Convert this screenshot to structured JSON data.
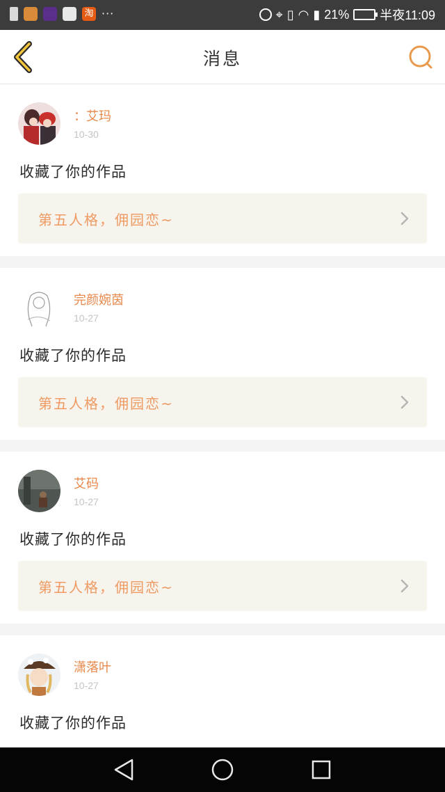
{
  "status_bar": {
    "battery_percent": "21%",
    "time": "半夜11:09",
    "app_badge": "淘",
    "overflow": "···"
  },
  "header": {
    "title": "消息",
    "accent_color": "#e89a4c"
  },
  "messages": [
    {
      "username": "：艾玛",
      "date": "10-30",
      "action": "收藏了你的作品",
      "work_title": "第五人格，佣园恋~"
    },
    {
      "username": "完颜婉茵",
      "date": "10-27",
      "action": "收藏了你的作品",
      "work_title": "第五人格，佣园恋~"
    },
    {
      "username": "艾码",
      "date": "10-27",
      "action": "收藏了你的作品",
      "work_title": "第五人格，佣园恋~"
    },
    {
      "username": "潇落叶",
      "date": "10-27",
      "action": "收藏了你的作品"
    }
  ]
}
